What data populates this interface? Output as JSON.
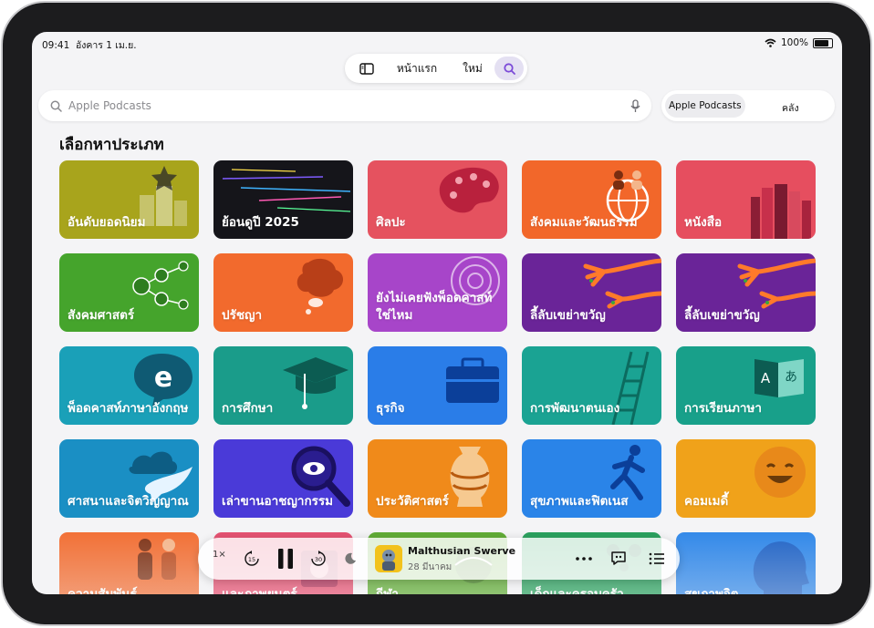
{
  "status": {
    "time": "09:41",
    "date": "อังคาร 1 เม.ย.",
    "battery": "100%"
  },
  "tabs": {
    "home": "หน้าแรก",
    "new": "ใหม่"
  },
  "search": {
    "placeholder": "Apple Podcasts"
  },
  "scope": {
    "apple": "Apple Podcasts",
    "library": "คลัง"
  },
  "section": {
    "title": "เลือกหาประเภท"
  },
  "tiles": [
    {
      "label": "อันดับยอดนิยม",
      "color": "#a8a41c",
      "icon": "trophy-star-icon"
    },
    {
      "label": "ย้อนดูปี 2025",
      "color": "#15151a",
      "icon": "light-streaks-icon"
    },
    {
      "label": "ศิลปะ",
      "color": "#e5525f",
      "icon": "palette-icon"
    },
    {
      "label": "สังคมและวัฒนธรรม",
      "color": "#f2672a",
      "icon": "people-globe-icon"
    },
    {
      "label": "หนังสือ",
      "color": "#e64e5f",
      "icon": "books-icon"
    },
    {
      "label": "สังคมศาสตร์",
      "color": "#45a42c",
      "icon": "network-people-icon"
    },
    {
      "label": "ปรัชญา",
      "color": "#f26a2d",
      "icon": "thought-bubble-icon"
    },
    {
      "label": "ยังไม่เคยฟังพ็อดคาสท์ใช่ไหม",
      "color": "#a745c9",
      "icon": "podcast-icon"
    },
    {
      "label": "ลี้ลับเขย่าขวัญ",
      "color": "#6a2498",
      "icon": "claw-hand-icon"
    },
    {
      "label": "ลี้ลับเขย่าขวัญ",
      "color": "#6a2498",
      "icon": "claw-hand-icon"
    },
    {
      "label": "พ็อดคาสท์ภาษาอังกฤษ",
      "color": "#1aa0b8",
      "icon": "speech-e-icon"
    },
    {
      "label": "การศึกษา",
      "color": "#1a9c8a",
      "icon": "graduation-cap-icon"
    },
    {
      "label": "ธุรกิจ",
      "color": "#2a7de8",
      "icon": "briefcase-icon"
    },
    {
      "label": "การพัฒนาตนเอง",
      "color": "#1aa393",
      "icon": "ladder-icon"
    },
    {
      "label": "การเรียนภาษา",
      "color": "#18a08a",
      "icon": "language-book-icon"
    },
    {
      "label": "ศาสนาและจิตวิญญาณ",
      "color": "#1a8fc4",
      "icon": "dove-cloud-icon"
    },
    {
      "label": "เล่าขานอาชญากรรม",
      "color": "#4a3ad8",
      "icon": "magnifier-eye-icon"
    },
    {
      "label": "ประวัติศาสตร์",
      "color": "#f08a1a",
      "icon": "amphora-icon"
    },
    {
      "label": "สุขภาพและฟิตเนส",
      "color": "#2a84e8",
      "icon": "runner-icon"
    },
    {
      "label": "คอมเมดี้",
      "color": "#f0a21a",
      "icon": "laughing-face-icon"
    },
    {
      "label": "ความสัมพันธ์",
      "color": "#f26a2d",
      "icon": "couple-icon"
    },
    {
      "label": "และภาพยนตร์",
      "color": "#e5486a",
      "icon": "film-icon"
    },
    {
      "label": "กีฬา",
      "color": "#58a82a",
      "icon": "sports-icon"
    },
    {
      "label": "เด็กและครอบครัว",
      "color": "#1e9c55",
      "icon": "family-icon"
    },
    {
      "label": "สุขภาพจิต",
      "color": "#2a84e8",
      "icon": "head-profile-icon"
    }
  ],
  "player": {
    "speed": "1×",
    "title": "Malthusian Swerve",
    "date": "28 มีนาคม",
    "skip_back": "15",
    "skip_fwd": "30"
  }
}
